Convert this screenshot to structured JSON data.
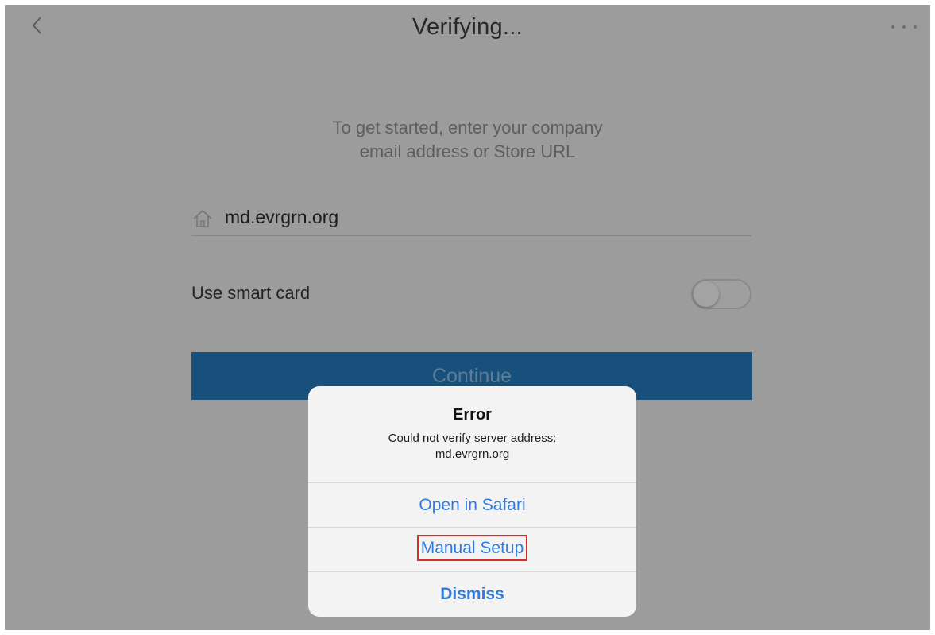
{
  "nav": {
    "title": "Verifying...",
    "back_icon": "chevron-left-icon",
    "more_icon": "more-dots-icon"
  },
  "intro": {
    "line1": "To get started, enter your company",
    "line2": "email address or Store URL"
  },
  "email_field": {
    "icon": "home-icon",
    "value": "md.evrgrn.org"
  },
  "smart_card": {
    "label": "Use smart card",
    "enabled": false
  },
  "continue_label": "Continue",
  "alert": {
    "title": "Error",
    "message_line1": "Could not verify server address:",
    "message_line2": "md.evrgrn.org",
    "actions": [
      {
        "label": "Open in Safari"
      },
      {
        "label": "Manual Setup",
        "highlighted": true
      },
      {
        "label": "Dismiss"
      }
    ]
  },
  "colors": {
    "overlay_background": "#9c9c9c",
    "continue_button": "#17507a",
    "alert_action_text": "#2e7cdc",
    "highlight_box": "#d42c2c"
  }
}
